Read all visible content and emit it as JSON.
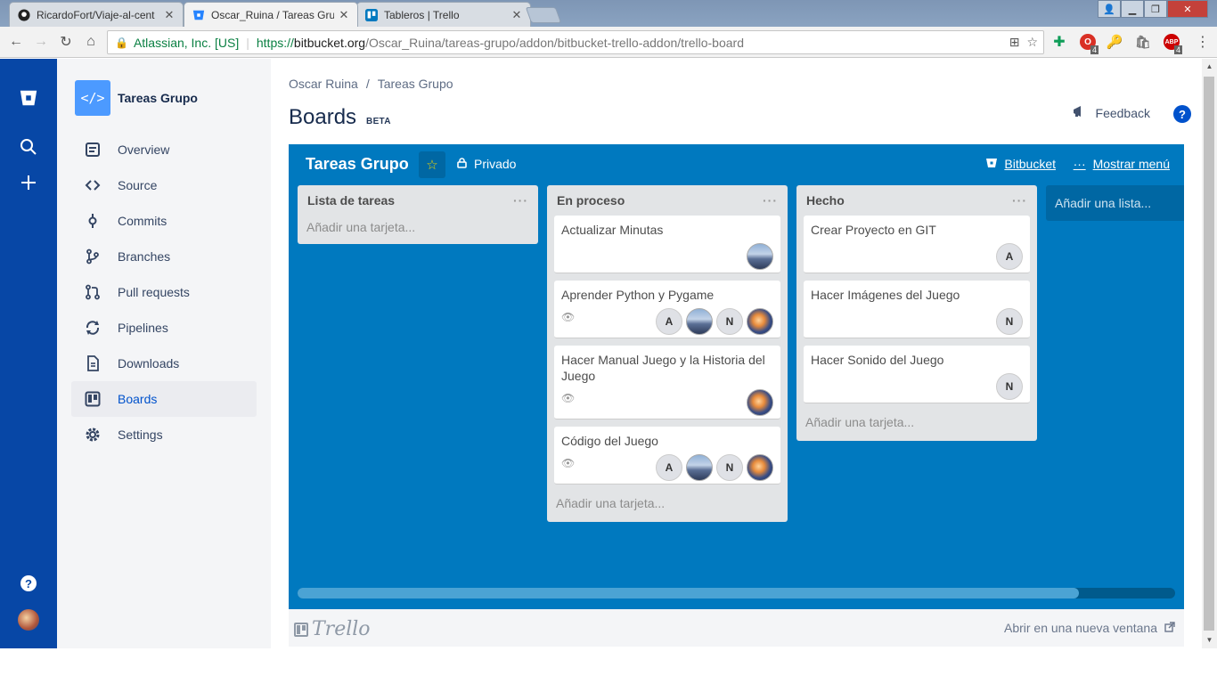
{
  "browser": {
    "tabs": [
      {
        "title": "RicardoFort/Viaje-al-cent",
        "active": false
      },
      {
        "title": "Oscar_Ruina / Tareas Gru",
        "active": true
      },
      {
        "title": "Tableros | Trello",
        "active": false
      }
    ],
    "address": {
      "org": "Atlassian, Inc. [US]",
      "scheme": "https://",
      "host": "bitbucket.org",
      "path": "/Oscar_Ruina/tareas-grupo/addon/bitbucket-trello-addon/trello-board"
    },
    "ext_badges": [
      "4",
      "4"
    ]
  },
  "sidebar": {
    "project_name": "Tareas Grupo",
    "project_icon_glyph": "</>",
    "items": [
      {
        "label": "Overview",
        "icon": "overview-icon"
      },
      {
        "label": "Source",
        "icon": "source-icon"
      },
      {
        "label": "Commits",
        "icon": "commits-icon"
      },
      {
        "label": "Branches",
        "icon": "branches-icon"
      },
      {
        "label": "Pull requests",
        "icon": "pull-requests-icon"
      },
      {
        "label": "Pipelines",
        "icon": "pipelines-icon"
      },
      {
        "label": "Downloads",
        "icon": "downloads-icon"
      },
      {
        "label": "Boards",
        "icon": "boards-icon",
        "selected": true
      },
      {
        "label": "Settings",
        "icon": "settings-icon"
      }
    ]
  },
  "header": {
    "breadcrumb": [
      "Oscar Ruina",
      "Tareas Grupo"
    ],
    "title": "Boards",
    "badge": "BETA",
    "feedback": "Feedback",
    "help": "?"
  },
  "board": {
    "name": "Tareas Grupo",
    "visibility": "Privado",
    "bitbucket_link": "Bitbucket",
    "menu_link": "Mostrar menú",
    "add_list": "Añadir una lista...",
    "add_card": "Añadir una tarjeta...",
    "lists": [
      {
        "title": "Lista de tareas",
        "cards": []
      },
      {
        "title": "En proceso",
        "cards": [
          {
            "title": "Actualizar Minutas",
            "watch": false,
            "members": [
              "photo-a"
            ]
          },
          {
            "title": "Aprender Python y Pygame",
            "watch": true,
            "members": [
              "A",
              "photo-a",
              "N",
              "photo-b"
            ]
          },
          {
            "title": "Hacer Manual Juego y la Historia del Juego",
            "watch": true,
            "members": [
              "photo-b"
            ]
          },
          {
            "title": "Código del Juego",
            "watch": true,
            "members": [
              "A",
              "photo-a",
              "N",
              "photo-b"
            ]
          }
        ]
      },
      {
        "title": "Hecho",
        "cards": [
          {
            "title": "Crear Proyecto en GIT",
            "watch": false,
            "members": [
              "A"
            ]
          },
          {
            "title": "Hacer Imágenes del Juego",
            "watch": false,
            "members": [
              "N"
            ]
          },
          {
            "title": "Hacer Sonido del Juego",
            "watch": false,
            "members": [
              "N"
            ]
          }
        ]
      }
    ],
    "scroll_fraction": 0.89
  },
  "footer": {
    "logo": "Trello",
    "open_new": "Abrir en una nueva ventana"
  },
  "colors": {
    "global_nav": "#0747a6",
    "board_bg": "#0079bf",
    "selected_text": "#0052cc"
  }
}
